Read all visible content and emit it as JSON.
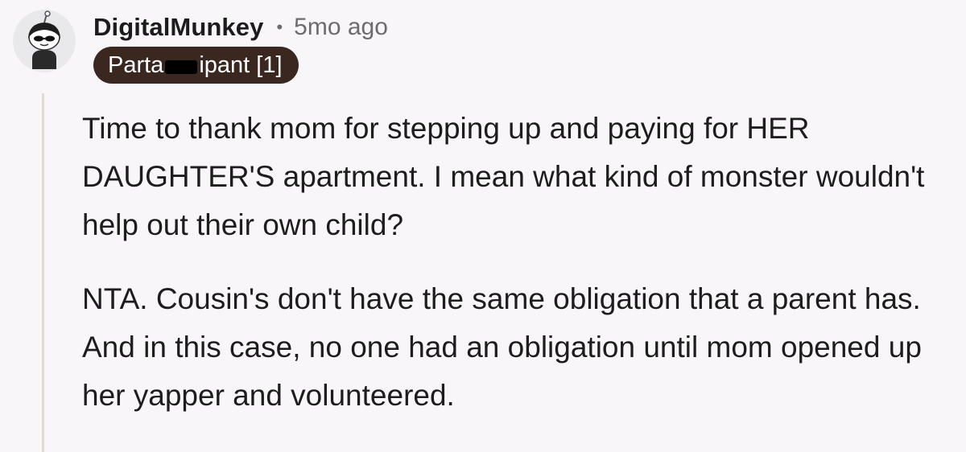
{
  "comment": {
    "author": "DigitalMunkey",
    "separator": "•",
    "timestamp": "5mo ago",
    "flair": {
      "before": "Parta",
      "after": "ipant [1]",
      "background": "#3a2820"
    },
    "paragraphs": [
      "Time to thank mom for stepping up and paying for HER DAUGHTER'S apartment. I mean what kind of monster wouldn't help out their own child?",
      "NTA. Cousin's don't have the same obligation that a parent has. And in this case, no one had an obligation until mom opened up her yapper and volunteered."
    ]
  },
  "icons": {
    "avatar": "snoo-avatar-with-sunglasses",
    "redaction": "redaction-bar"
  },
  "colors": {
    "background": "#f8f6f8",
    "thread_line": "#e3d9d3",
    "meta_text": "#6f6a6f"
  }
}
